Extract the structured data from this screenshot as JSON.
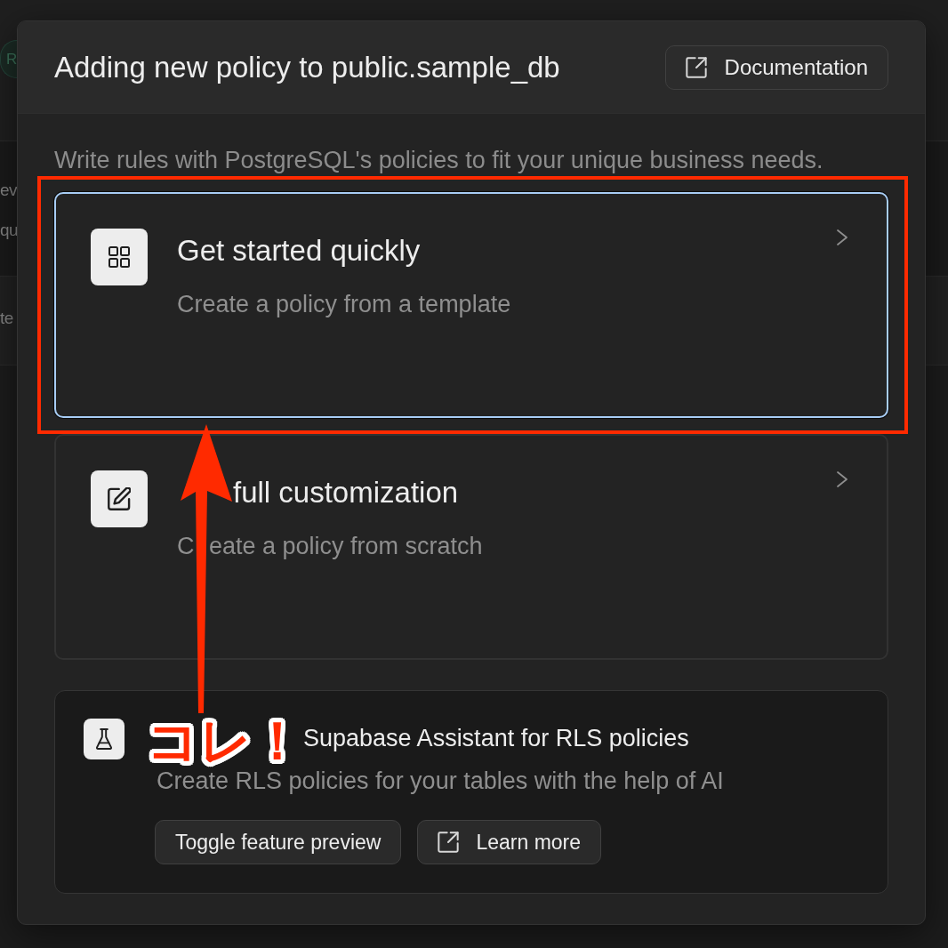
{
  "background_page": {
    "badge": "R",
    "table_rows": [
      {
        "lines": [
          "ev",
          "qu"
        ]
      },
      {
        "lines": [
          "te"
        ]
      }
    ]
  },
  "dialog": {
    "title": "Adding new policy to public.sample_db",
    "documentation_button": "Documentation",
    "description": "Write rules with PostgreSQL's policies to fit your unique business needs.",
    "options": [
      {
        "kind": "template",
        "title": [
          "Get started quickly"
        ],
        "subtitle": [
          "Create a policy from a template"
        ],
        "selected": true,
        "highlighted": true
      },
      {
        "kind": "custom",
        "title": [
          "full customization"
        ],
        "subtitle": [
          "C",
          "eate a policy from scratch"
        ],
        "selected": false,
        "highlighted": false
      }
    ],
    "assistant_card": {
      "title": [
        "Supabase Assistant for RLS policies"
      ],
      "subtitle": [
        "Create RLS policies for your tables with the help of AI"
      ],
      "buttons": [
        {
          "kind": "plain",
          "label": "Toggle feature preview"
        },
        {
          "kind": "external",
          "label": "Learn more"
        }
      ]
    }
  },
  "annotation": {
    "callout": "コレ！"
  }
}
